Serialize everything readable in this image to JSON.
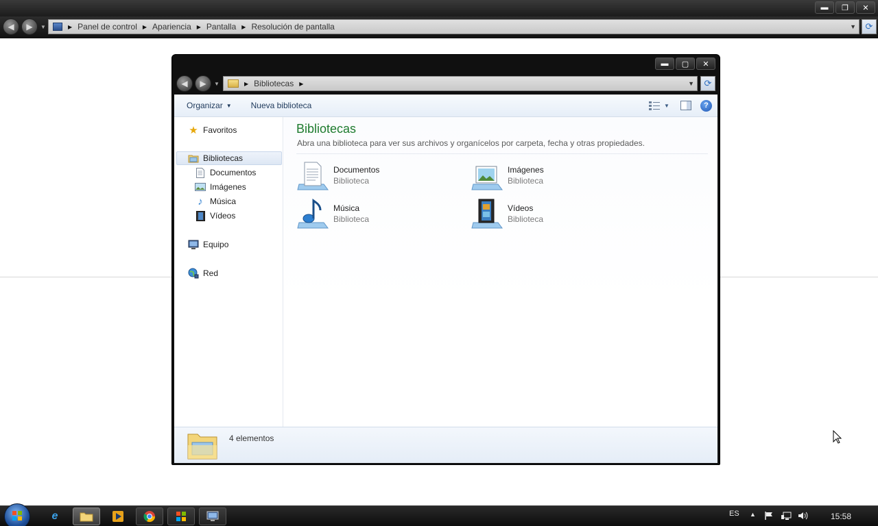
{
  "background_window": {
    "breadcrumb": [
      "Panel de control",
      "Apariencia",
      "Pantalla",
      "Resolución de pantalla"
    ],
    "caption": {
      "minimize": "▬",
      "maximize": "❐",
      "close": "✕"
    }
  },
  "explorer": {
    "caption": {
      "minimize": "▬",
      "maximize": "▢",
      "close": "✕"
    },
    "address": {
      "crumb": "Bibliotecas"
    },
    "toolbar": {
      "organize": "Organizar",
      "new_library": "Nueva biblioteca"
    },
    "sidebar": {
      "favorites": "Favoritos",
      "libraries": "Bibliotecas",
      "libraries_items": [
        "Documentos",
        "Imágenes",
        "Música",
        "Vídeos"
      ],
      "computer": "Equipo",
      "network": "Red"
    },
    "content": {
      "title": "Bibliotecas",
      "subtitle": "Abra una biblioteca para ver sus archivos y organícelos por carpeta, fecha y otras propiedades.",
      "libraries": [
        {
          "name": "Documentos",
          "type": "Biblioteca",
          "icon": "documents-library-icon"
        },
        {
          "name": "Imágenes",
          "type": "Biblioteca",
          "icon": "pictures-library-icon"
        },
        {
          "name": "Música",
          "type": "Biblioteca",
          "icon": "music-library-icon"
        },
        {
          "name": "Vídeos",
          "type": "Biblioteca",
          "icon": "videos-library-icon"
        }
      ]
    },
    "details": {
      "count": "4 elementos"
    }
  },
  "taskbar": {
    "language": "ES",
    "time": "15:58"
  },
  "colors": {
    "title_green": "#1e7b2e",
    "toolbar_text": "#1e395b",
    "selection": "#dde7f4"
  }
}
